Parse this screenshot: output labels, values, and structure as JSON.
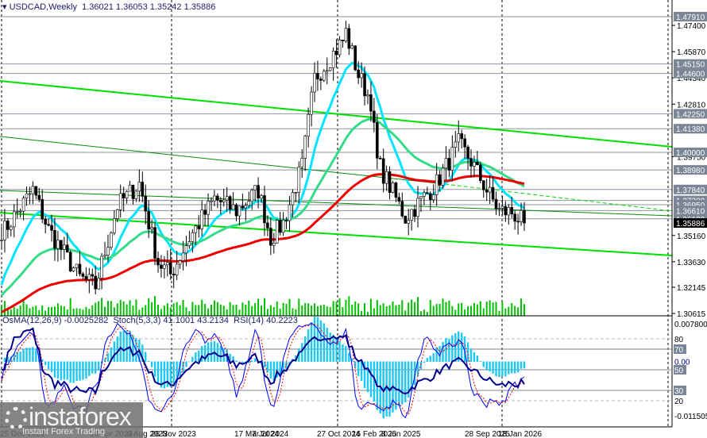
{
  "header": {
    "symbol": "USDCAD",
    "timeframe": "Weekly",
    "open": "1.36021",
    "high": "1.36053",
    "low": "1.35242",
    "close": "1.35886"
  },
  "indicators_label": {
    "osma": "OsMA(12,26,9) -0.0025282",
    "stoch": "Stoch(5,3,3) 41.1001 43.2134",
    "rsi": "RSI(14) 40.2223"
  },
  "logo": {
    "brand": "instaforex",
    "tagline": "Instant Forex Trading"
  },
  "colors": {
    "fast_ma": "#00e5ff",
    "mid_ma": "#33dd88",
    "slow_ma": "#ee0000",
    "trendline": "#00e000",
    "volume": "#00c000",
    "osma": "#1ec8f0",
    "stoch_main": "#0000ff",
    "stoch_signal": "#ff0000",
    "rsi": "#00008b",
    "level_label_bg": "#7a8595"
  },
  "chart_data": {
    "type": "candlestick",
    "symbol": "USDCAD",
    "timeframe": "Weekly",
    "ylim": [
      1.30615,
      1.4791
    ],
    "y_ticks": [
      "1.47400",
      "1.45870",
      "1.44340",
      "1.42810",
      "1.39750",
      "1.35160",
      "1.33630",
      "1.32145",
      "1.30615"
    ],
    "price_levels": [
      "1.47910",
      "1.45150",
      "1.44600",
      "1.42250",
      "1.41380",
      "1.40000",
      "1.38980",
      "1.37840",
      "1.37200",
      "1.36950",
      "1.36610",
      "1.36130"
    ],
    "current_price": "1.35886",
    "x_ticks": [
      "25 Dec 2022",
      "16 Apr 2023",
      "6 Aug 2023",
      "26 Nov 2023",
      "17 Mar 2024",
      "7 Jul 2024",
      "27 Oct 2024",
      "16 Feb 2025",
      "8 Jun 2025",
      "28 Sep 2025",
      "18 Jan 2026"
    ],
    "approx_closes": [
      [
        "2023-01-01",
        1.355
      ],
      [
        "2023-03-05",
        1.378
      ],
      [
        "2023-04-09",
        1.355
      ],
      [
        "2023-06-18",
        1.327
      ],
      [
        "2023-07-23",
        1.322
      ],
      [
        "2023-09-10",
        1.369
      ],
      [
        "2023-10-29",
        1.382
      ],
      [
        "2023-12-10",
        1.336
      ],
      [
        "2024-01-07",
        1.329
      ],
      [
        "2024-02-18",
        1.35
      ],
      [
        "2024-04-14",
        1.373
      ],
      [
        "2024-06-02",
        1.366
      ],
      [
        "2024-07-21",
        1.378
      ],
      [
        "2024-08-18",
        1.35
      ],
      [
        "2024-09-15",
        1.359
      ],
      [
        "2024-10-27",
        1.392
      ],
      [
        "2024-11-24",
        1.443
      ],
      [
        "2025-01-26",
        1.465
      ],
      [
        "2025-02-02",
        1.47
      ],
      [
        "2025-03-02",
        1.445
      ],
      [
        "2025-03-30",
        1.43
      ],
      [
        "2025-04-13",
        1.395
      ],
      [
        "2025-06-15",
        1.362
      ],
      [
        "2025-07-13",
        1.37
      ],
      [
        "2025-08-24",
        1.382
      ],
      [
        "2025-10-12",
        1.405
      ],
      [
        "2025-11-09",
        1.395
      ],
      [
        "2025-12-14",
        1.378
      ],
      [
        "2026-01-11",
        1.366
      ],
      [
        "2026-02-08",
        1.365
      ],
      [
        "2026-03-08",
        1.35886
      ]
    ],
    "sub_window": {
      "osma_range": [
        -0.011505,
        0.0078
      ],
      "osma_top": "0.007800",
      "osma_bottom": "-0.011505",
      "levels": [
        "80",
        "70",
        "50",
        "30",
        "20"
      ],
      "zero": "0.00"
    }
  }
}
